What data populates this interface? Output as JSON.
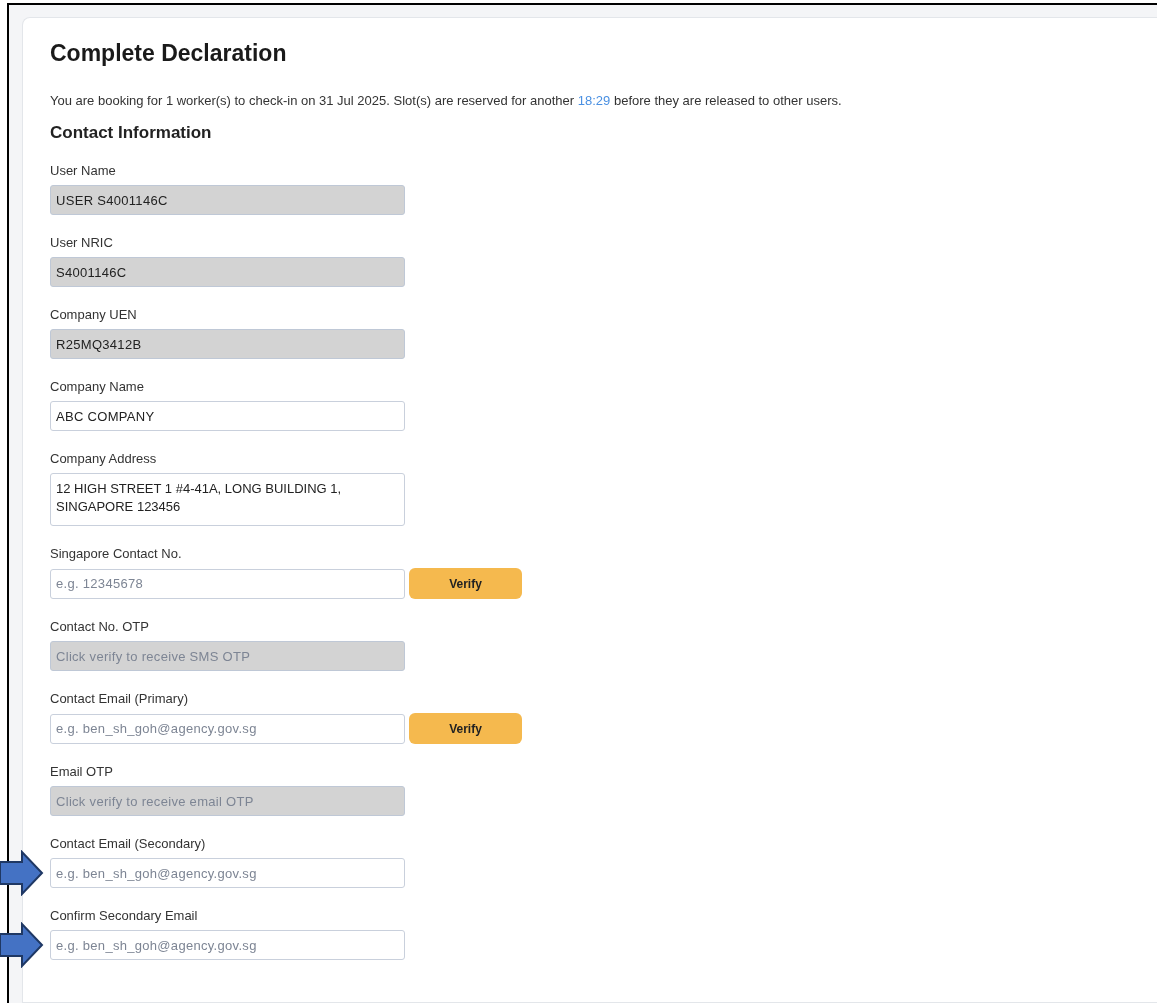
{
  "title": "Complete Declaration",
  "intro": {
    "before": "You are booking for 1 worker(s) to check-in on 31 Jul 2025. Slot(s) are reserved for another",
    "timer": "18:29",
    "after": "before they are released to other users."
  },
  "section": "Contact Information",
  "fields": [
    {
      "label": "User Name",
      "kind": "single",
      "disabled": true,
      "value": "USER S4001146C",
      "marked": false
    },
    {
      "label": "User NRIC",
      "kind": "single",
      "disabled": true,
      "value": "S4001146C",
      "marked": false
    },
    {
      "label": "Company UEN",
      "kind": "single",
      "disabled": true,
      "value": "R25MQ3412B",
      "marked": false
    },
    {
      "label": "Company Name",
      "kind": "single",
      "disabled": false,
      "value": "ABC COMPANY",
      "marked": false
    },
    {
      "label": "Company Address",
      "kind": "multi",
      "disabled": false,
      "value": "12 HIGH STREET 1 #4-41A, LONG BUILDING 1, SINGAPORE 123456",
      "marked": false
    },
    {
      "label": "Singapore Contact No.",
      "kind": "single",
      "disabled": false,
      "placeholder": "e.g. 12345678",
      "button": "Verify",
      "marked": false
    },
    {
      "label": "Contact No. OTP",
      "kind": "single",
      "disabled": true,
      "placeholder": "Click verify to receive SMS OTP",
      "marked": false
    },
    {
      "label": "Contact Email (Primary)",
      "kind": "single",
      "disabled": false,
      "placeholder": "e.g. ben_sh_goh@agency.gov.sg",
      "button": "Verify",
      "marked": false
    },
    {
      "label": "Email OTP",
      "kind": "single",
      "disabled": true,
      "placeholder": "Click verify to receive email OTP",
      "marked": false
    },
    {
      "label": "Contact Email (Secondary)",
      "kind": "single",
      "disabled": false,
      "placeholder": "e.g. ben_sh_goh@agency.gov.sg",
      "marked": true
    },
    {
      "label": "Confirm Secondary Email",
      "kind": "single",
      "disabled": false,
      "placeholder": "e.g. ben_sh_goh@agency.gov.sg",
      "marked": true
    }
  ]
}
